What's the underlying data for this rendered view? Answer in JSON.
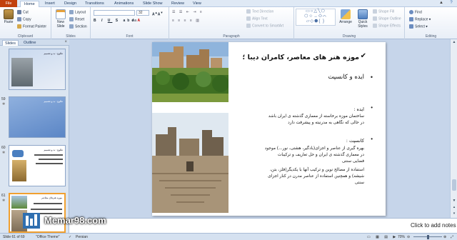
{
  "tabs": [
    "File",
    "Home",
    "Insert",
    "Design",
    "Transitions",
    "Animations",
    "Slide Show",
    "Review",
    "View"
  ],
  "active_tab_index": 1,
  "ribbon": {
    "clipboard": {
      "paste": "Paste",
      "cut": "Cut",
      "copy": "Copy",
      "format_painter": "Format Painter",
      "label": "Clipboard"
    },
    "slides": {
      "new_slide": "New Slide",
      "layout": "Layout",
      "reset": "Reset",
      "section": "Section",
      "label": "Slides"
    },
    "font": {
      "size": "32",
      "label": "Font"
    },
    "paragraph": {
      "text_direction": "Text Direction",
      "align_text": "Align Text",
      "convert_smartart": "Convert to SmartArt",
      "label": "Paragraph"
    },
    "drawing": {
      "arrange": "Arrange",
      "quick_styles": "Quick Styles",
      "shape_fill": "Shape Fill",
      "shape_outline": "Shape Outline",
      "shape_effects": "Shape Effects",
      "label": "Drawing"
    },
    "editing": {
      "find": "Find",
      "replace": "Replace",
      "select": "Select",
      "label": "Editing"
    }
  },
  "pane": {
    "tabs": [
      "Slides",
      "Outline"
    ],
    "thumbs": [
      {
        "num": "",
        "title": "طلوع : بد و تقسیم"
      },
      {
        "num": "59",
        "title": "طلوع : بد و تقسیم"
      },
      {
        "num": "60",
        "title": "طلوع : بد و تقسیم"
      },
      {
        "num": "61",
        "title": "موزه هنرهای معاصر"
      }
    ]
  },
  "slide": {
    "title": "موزه هنر های معاصر، کامران دیبا ؛",
    "bullet1": "ایده و کانسپت",
    "idea_label": "ایده :",
    "idea_line1": "ساختمان موزه برخاسته از معماری گذشته ی ایران باشد",
    "idea_line2": "در حالی که نگاهی به مدرنیته و پیشرفت دارد",
    "concept_label": "کانسپت :",
    "concept_line1": "بهره گیری از عناصر و اجزای(بادگیر، هشتی، نور...) موجود",
    "concept_line2": "در معماری گذشته ی ایران و حل تعاریف و ترکیبات",
    "concept_line3": "فضایی سنتی",
    "concept_line4": "استفاده از مصالح نوین و ترکیب آنها با یکدیگر(فلز، بتن،",
    "concept_line5": "شیشه) و همچنین استفاده از عناصر مدرن در کنار اجزای",
    "concept_line6": "سنتی"
  },
  "notes_placeholder": "Click to add notes",
  "status": {
    "slide_info": "Slide 61 of 69",
    "theme": "\"Office Theme\"",
    "language": "Persian",
    "zoom": "70%"
  },
  "watermark": "Memar98.com",
  "colors": {
    "file_tab": "#c2410c",
    "accent": "#1f3a60",
    "pane_bg": "#dbe5f1",
    "work_bg": "#c6d5ea"
  }
}
